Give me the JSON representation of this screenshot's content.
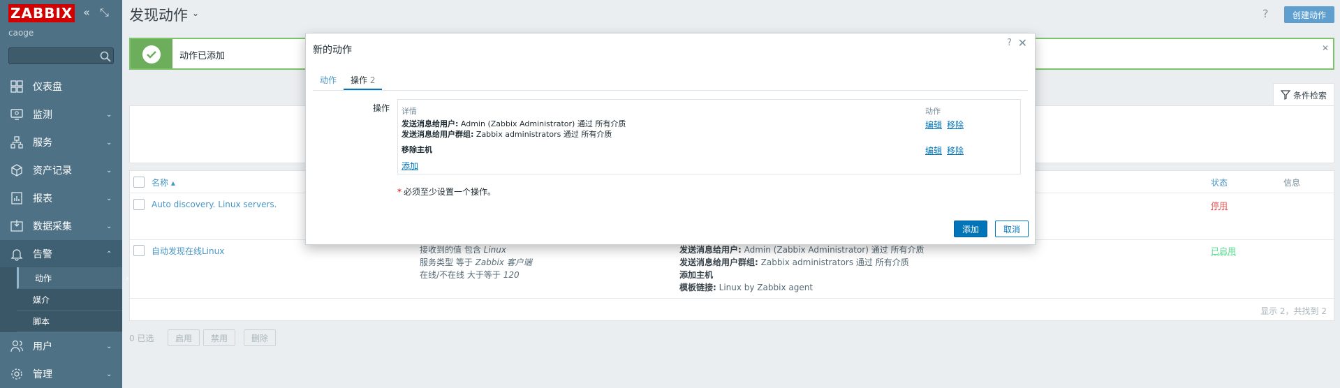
{
  "sidebar": {
    "logo": "ZABBIX",
    "username": "caoge",
    "search_placeholder": "",
    "menu": [
      {
        "label": "仪表盘"
      },
      {
        "label": "监测"
      },
      {
        "label": "服务"
      },
      {
        "label": "资产记录"
      },
      {
        "label": "报表"
      },
      {
        "label": "数据采集"
      },
      {
        "label": "告警"
      },
      {
        "label": "用户"
      },
      {
        "label": "管理"
      }
    ],
    "submenu": [
      "动作",
      "媒介",
      "脚本"
    ]
  },
  "header": {
    "title": "发现动作",
    "help": "?",
    "create_button": "创建动作"
  },
  "message": {
    "text": "动作已添加"
  },
  "filter": {
    "label": "条件检索"
  },
  "table": {
    "headers": {
      "name": "名称",
      "status": "状态",
      "info": "信息"
    },
    "rows": [
      {
        "name": "Auto discovery. Linux servers.",
        "status": "停用"
      },
      {
        "name": "自动发现在线Linux",
        "conditions": [
          {
            "prefix": "接收到的值 包含 ",
            "value": "Linux"
          },
          {
            "prefix": "服务类型 等于 ",
            "value": "Zabbix 客户端"
          },
          {
            "prefix": "在线/不在线 大于等于 ",
            "value": "120"
          }
        ],
        "operations": [
          {
            "bold": "发送消息给用户:",
            "text": " Admin (Zabbix Administrator) 通过 所有介质"
          },
          {
            "bold": "发送消息给用户群组:",
            "text": " Zabbix administrators 通过 所有介质"
          },
          {
            "bold": "添加主机",
            "text": ""
          },
          {
            "bold": "模板链接:",
            "text": " Linux by Zabbix agent"
          }
        ],
        "status": "已启用"
      }
    ],
    "footer": "显示 2，共找到 2"
  },
  "mass_actions": {
    "selected": "0 已选",
    "enable": "启用",
    "disable": "禁用",
    "delete": "删除"
  },
  "modal": {
    "title": "新的动作",
    "help": "?",
    "tabs": {
      "action": "动作",
      "operations": "操作",
      "operations_count": "2"
    },
    "operations_label": "操作",
    "col_details": "详情",
    "col_action": "动作",
    "op1_line1_bold": "发送消息给用户:",
    "op1_line1_text": " Admin (Zabbix Administrator) 通过 所有介质",
    "op1_line2_bold": "发送消息给用户群组:",
    "op1_line2_text": " Zabbix administrators 通过 所有介质",
    "op2_bold": "移除主机",
    "edit": "编辑",
    "remove": "移除",
    "add_link": "添加",
    "required_note": "必须至少设置一个操作。",
    "add_button": "添加",
    "cancel_button": "取消"
  }
}
